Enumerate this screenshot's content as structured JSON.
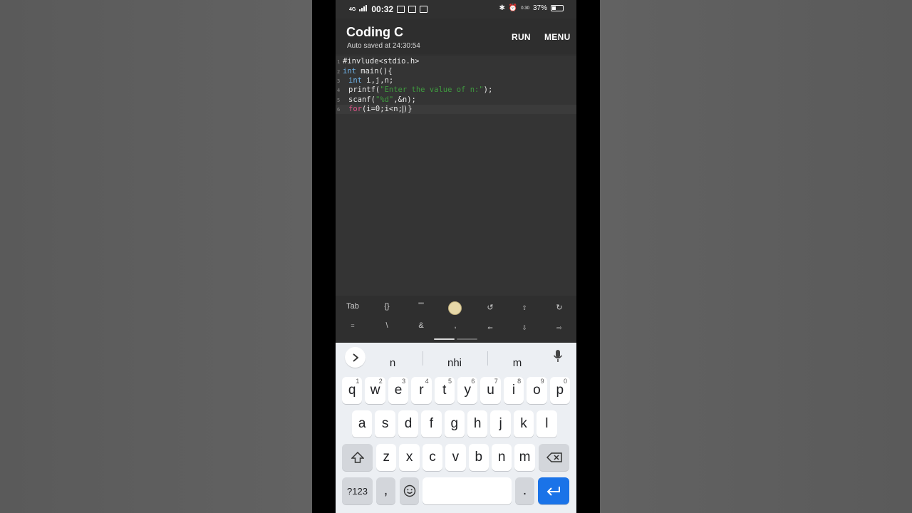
{
  "statusbar": {
    "time": "00:32",
    "network": "4G",
    "speed": "0.30",
    "battery_pct": "37%",
    "battery_level": 0.37
  },
  "app": {
    "title": "Coding C",
    "subtitle": "Auto saved at 24:30:54",
    "run_label": "RUN",
    "menu_label": "MENU"
  },
  "editor": {
    "lines": [
      {
        "num": "1",
        "text": "#invlude<stdio.h>"
      },
      {
        "num": "2",
        "text_kw": "int",
        "text_rest": " main(){"
      },
      {
        "num": "3",
        "text_kw": "int",
        "text_rest": " i,j,n;"
      },
      {
        "num": "4",
        "text_pre": "printf(",
        "text_str": "\"Enter the value of n:\"",
        "text_post": ");"
      },
      {
        "num": "5",
        "text_pre": "scanf(",
        "text_str": "\"%d\"",
        "text_post": ",&n);"
      },
      {
        "num": "6",
        "text_kw": "for",
        "text_rest": "(i=0;i<n;",
        "text_after": ")}"
      }
    ]
  },
  "toolbar": {
    "row1": [
      "Tab",
      "{}",
      "\"\"",
      "",
      "↺",
      "⇧",
      "↻"
    ],
    "row2": [
      "=",
      "\\",
      "&",
      ",",
      "⇐",
      "⇩",
      "⇨"
    ]
  },
  "keyboard": {
    "suggestions": [
      "n",
      "nhi",
      "m"
    ],
    "row1": [
      {
        "k": "q",
        "h": "1"
      },
      {
        "k": "w",
        "h": "2"
      },
      {
        "k": "e",
        "h": "3"
      },
      {
        "k": "r",
        "h": "4"
      },
      {
        "k": "t",
        "h": "5"
      },
      {
        "k": "y",
        "h": "6"
      },
      {
        "k": "u",
        "h": "7"
      },
      {
        "k": "i",
        "h": "8"
      },
      {
        "k": "o",
        "h": "9"
      },
      {
        "k": "p",
        "h": "0"
      }
    ],
    "row2": [
      "a",
      "s",
      "d",
      "f",
      "g",
      "h",
      "j",
      "k",
      "l"
    ],
    "row3": [
      "z",
      "x",
      "c",
      "v",
      "b",
      "n",
      "m"
    ],
    "symbols_label": "?123",
    "comma_label": ",",
    "period_label": "."
  },
  "colors": {
    "accent": "#1a73e8",
    "keyword": "#6fb3e8",
    "keyword_control": "#e0568a",
    "string": "#3f9b3f"
  }
}
